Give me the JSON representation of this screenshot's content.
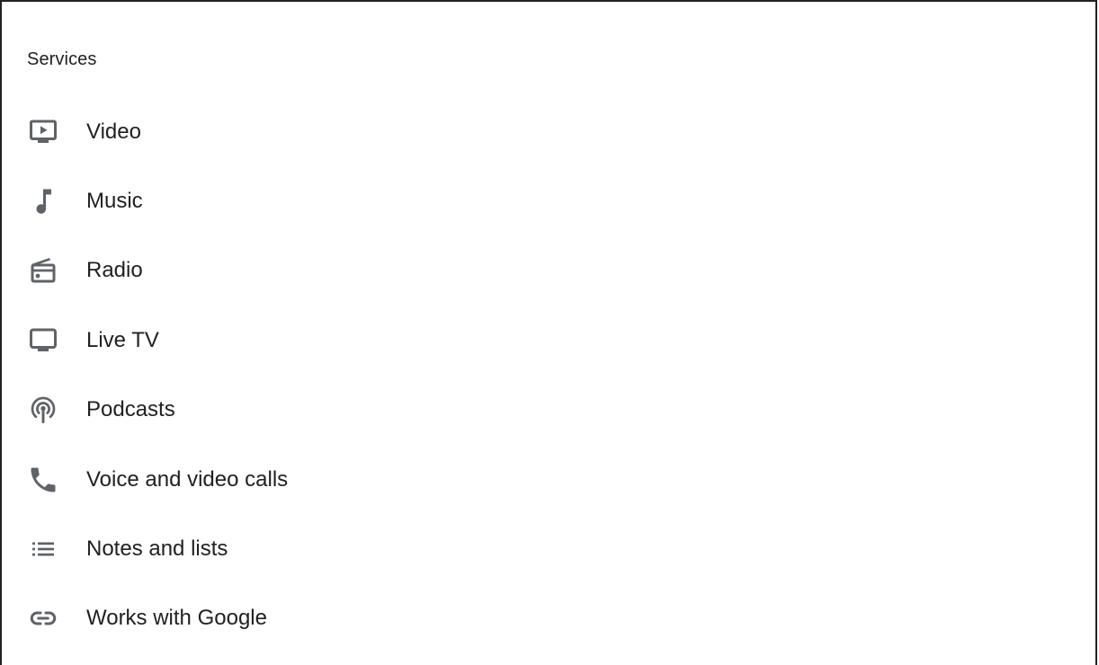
{
  "section": {
    "title": "Services"
  },
  "items": [
    {
      "label": "Video",
      "icon": "video-icon"
    },
    {
      "label": "Music",
      "icon": "music-note-icon"
    },
    {
      "label": "Radio",
      "icon": "radio-icon"
    },
    {
      "label": "Live TV",
      "icon": "tv-icon"
    },
    {
      "label": "Podcasts",
      "icon": "podcasts-icon"
    },
    {
      "label": "Voice and video calls",
      "icon": "phone-icon"
    },
    {
      "label": "Notes and lists",
      "icon": "list-icon"
    },
    {
      "label": "Works with Google",
      "icon": "link-icon"
    }
  ],
  "colors": {
    "text": "#202124",
    "icon": "#5f6368",
    "border": "#222222",
    "background": "#ffffff"
  }
}
